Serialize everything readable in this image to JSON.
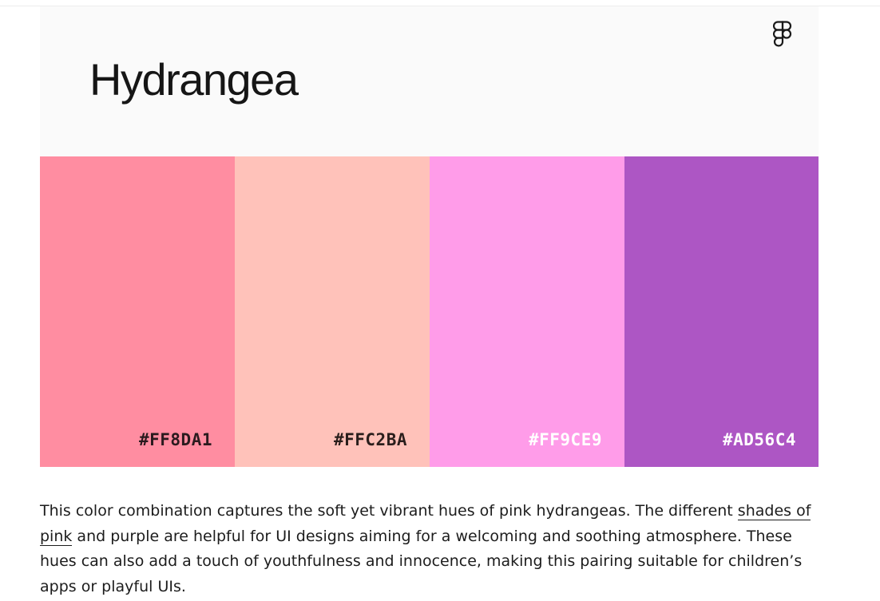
{
  "palette": {
    "title": "Hydrangea",
    "logo_icon": "figma-icon",
    "swatches": [
      {
        "hex": "#FF8DA1",
        "label": "#FF8DA1",
        "text_color": "#2a1a1e"
      },
      {
        "hex": "#FFC2BA",
        "label": "#FFC2BA",
        "text_color": "#2a1e1c"
      },
      {
        "hex": "#FF9CE9",
        "label": "#FF9CE9",
        "text_color": "#ffffff"
      },
      {
        "hex": "#AD56C4",
        "label": "#AD56C4",
        "text_color": "#ffffff"
      }
    ]
  },
  "description": {
    "before_link": "This color combination captures the soft yet vibrant hues of pink hydrangeas. The different ",
    "link_text": "shades of pink",
    "after_link": " and purple are helpful for UI designs aiming for a welcoming and soothing atmosphere. These hues can also add a touch of youthfulness and innocence, making this pairing suitable for children’s apps or playful UIs."
  }
}
